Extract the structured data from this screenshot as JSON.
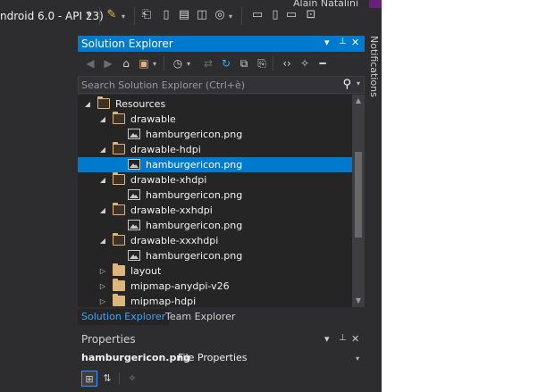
{
  "top_toolbar": {
    "device_label": "ndroid 6.0 - API 23)",
    "user_name": "Alain Natalini"
  },
  "solution_explorer": {
    "title": "Solution Explorer",
    "controls": {
      "dropdown": "▾",
      "pin": "📌",
      "close": "✕"
    },
    "search_placeholder": "Search Solution Explorer (Ctrl+è)",
    "tree": [
      {
        "label": "Resources",
        "type": "folder",
        "level": 0,
        "expanded": true,
        "selected": false
      },
      {
        "label": "drawable",
        "type": "folder",
        "level": 1,
        "expanded": true,
        "selected": false
      },
      {
        "label": "hamburgericon.png",
        "type": "file",
        "level": 2,
        "selected": false
      },
      {
        "label": "drawable-hdpi",
        "type": "folder",
        "level": 1,
        "expanded": true,
        "selected": false
      },
      {
        "label": "hamburgericon.png",
        "type": "file",
        "level": 2,
        "selected": true
      },
      {
        "label": "drawable-xhdpi",
        "type": "folder",
        "level": 1,
        "expanded": true,
        "selected": false
      },
      {
        "label": "hamburgericon.png",
        "type": "file",
        "level": 2,
        "selected": false
      },
      {
        "label": "drawable-xxhdpi",
        "type": "folder",
        "level": 1,
        "expanded": true,
        "selected": false
      },
      {
        "label": "hamburgericon.png",
        "type": "file",
        "level": 2,
        "selected": false
      },
      {
        "label": "drawable-xxxhdpi",
        "type": "folder",
        "level": 1,
        "expanded": true,
        "selected": false
      },
      {
        "label": "hamburgericon.png",
        "type": "file",
        "level": 2,
        "selected": false
      },
      {
        "label": "layout",
        "type": "folder",
        "level": 1,
        "expanded": false,
        "selected": false
      },
      {
        "label": "mipmap-anydpi-v26",
        "type": "folder",
        "level": 1,
        "expanded": false,
        "selected": false
      },
      {
        "label": "mipmap-hdpi",
        "type": "folder",
        "level": 1,
        "expanded": false,
        "selected": false
      }
    ],
    "tabs": [
      {
        "label": "Solution Explorer",
        "active": true
      },
      {
        "label": "Team Explorer",
        "active": false
      }
    ]
  },
  "properties": {
    "title": "Properties",
    "object_name": "hamburgericon.png",
    "object_type": "File Properties"
  },
  "notifications": {
    "label": "Notifications"
  },
  "colors": {
    "accent": "#007acc",
    "background": "#2d2d30",
    "tree_background": "#252526",
    "folder": "#dcb67a",
    "text": "#f1f1f1"
  }
}
